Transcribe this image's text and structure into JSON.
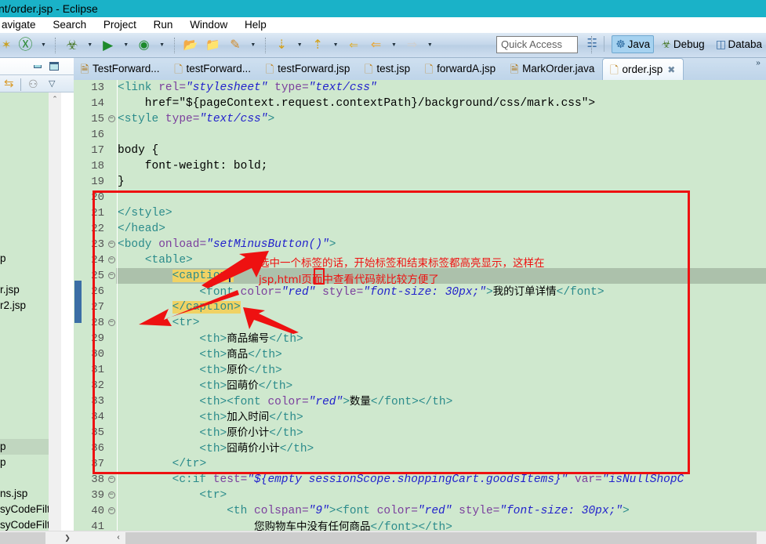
{
  "window": {
    "title": "nt/order.jsp - Eclipse",
    "titlebar_color": "#1ab2c8"
  },
  "menubar": {
    "items": [
      {
        "label": "avigate"
      },
      {
        "label": "Search"
      },
      {
        "label": "Project"
      },
      {
        "label": "Run"
      },
      {
        "label": "Window"
      },
      {
        "label": "Help"
      }
    ]
  },
  "toolbar": {
    "quick_access_placeholder": "Quick Access",
    "items": [
      {
        "name": "new-wizard-icon",
        "glyph": "✦",
        "color": "#c9a227"
      },
      {
        "name": "new-java-class-icon",
        "glyph": "Ⓖ",
        "color": "#2e8b37"
      },
      {
        "name": "new-dropdown-arrow",
        "glyph": "▼"
      },
      {
        "name": "debug-icon",
        "glyph": "☣",
        "color": "#4b7a2c"
      },
      {
        "name": "debug-dropdown-arrow",
        "glyph": "▼"
      },
      {
        "name": "run-icon",
        "glyph": "▶",
        "color": "#1d8a2c"
      },
      {
        "name": "run-dropdown-arrow",
        "glyph": "▼"
      },
      {
        "name": "run-as-server-icon",
        "glyph": "◉",
        "color": "#1d8a2c"
      },
      {
        "name": "run-as-dropdown-arrow",
        "glyph": "▼"
      },
      {
        "name": "open-type-icon",
        "glyph": "📂",
        "color": "#d99b2b"
      },
      {
        "name": "open-folder-icon",
        "glyph": "📁",
        "color": "#d99b2b"
      },
      {
        "name": "marker-pen-icon",
        "glyph": "✒",
        "color": "#d08a2a"
      },
      {
        "name": "marker-dropdown-arrow",
        "glyph": "▼"
      },
      {
        "name": "next-annotation-icon",
        "glyph": "⇣",
        "color": "#d4a017"
      },
      {
        "name": "next-annotation-dropdown-arrow",
        "glyph": "▼"
      },
      {
        "name": "previous-annotation-icon",
        "glyph": "⇡",
        "color": "#d4a017"
      },
      {
        "name": "previous-annotation-dropdown-arrow",
        "glyph": "▼"
      },
      {
        "name": "last-edit-location-icon",
        "glyph": "⇐",
        "color": "#e0b030"
      },
      {
        "name": "back-icon",
        "glyph": "⇐",
        "color": "#e8a83a"
      },
      {
        "name": "back-dropdown-arrow",
        "glyph": "▼"
      },
      {
        "name": "forward-icon",
        "glyph": "⇒",
        "color": "#cfcfcf"
      },
      {
        "name": "forward-dropdown-arrow",
        "glyph": "▼"
      }
    ]
  },
  "perspective_bar": {
    "open_perspective_icon": "open-perspective-icon",
    "items": [
      {
        "label": "Java",
        "icon": "java-perspective-icon",
        "active": true
      },
      {
        "label": "Debug",
        "icon": "debug-perspective-icon",
        "active": false
      },
      {
        "label": "Databa",
        "icon": "database-perspective-icon",
        "active": false
      }
    ]
  },
  "left_panel": {
    "minimize_label": "minimize",
    "maximize_label": "maximize",
    "tool_icons": [
      {
        "name": "link-with-editor-icon",
        "glyph": "⇆",
        "color": "#d99b2b"
      },
      {
        "name": "view-menu-collapse-icon",
        "glyph": "⚇",
        "color": "#8a8a8a"
      },
      {
        "name": "view-menu-icon",
        "glyph": "▽",
        "color": "#3c5a72"
      }
    ],
    "tree_items": [
      {
        "label": "",
        "selected": false
      },
      {
        "label": "",
        "selected": false
      },
      {
        "label": "",
        "selected": false
      },
      {
        "label": "",
        "selected": false
      },
      {
        "label": "",
        "selected": false
      },
      {
        "label": "",
        "selected": false
      },
      {
        "label": "",
        "selected": false
      },
      {
        "label": "",
        "selected": false
      },
      {
        "label": "",
        "selected": false
      },
      {
        "label": "",
        "selected": false
      },
      {
        "label": "p",
        "selected": false
      },
      {
        "label": "",
        "selected": false
      },
      {
        "label": "r.jsp",
        "selected": false
      },
      {
        "label": "r2.jsp",
        "selected": false
      },
      {
        "label": "",
        "selected": false
      },
      {
        "label": "",
        "selected": false
      },
      {
        "label": "",
        "selected": false
      },
      {
        "label": "",
        "selected": false
      },
      {
        "label": "",
        "selected": false
      },
      {
        "label": "",
        "selected": false
      },
      {
        "label": "",
        "selected": false
      },
      {
        "label": "",
        "selected": false
      },
      {
        "label": "p",
        "selected": true
      },
      {
        "label": "p",
        "selected": false
      },
      {
        "label": "",
        "selected": false
      },
      {
        "label": "ns.jsp",
        "selected": false
      },
      {
        "label": "syCodeFilter.",
        "selected": false
      },
      {
        "label": "syCodeFilterI",
        "selected": false
      }
    ],
    "scroll_up_icon": "⌃",
    "scroll_down_icon": "⌄",
    "scroll_right_icon": "❯"
  },
  "editor_tabs": {
    "more_tabs_icon": "»",
    "items": [
      {
        "label": "TestForward...",
        "icon": "java-file-icon",
        "active": false,
        "closable": false
      },
      {
        "label": "testForward...",
        "icon": "jsp-file-icon",
        "active": false,
        "closable": false
      },
      {
        "label": "testForward.jsp",
        "icon": "jsp-file-icon",
        "active": false,
        "closable": false
      },
      {
        "label": "test.jsp",
        "icon": "jsp-file-icon",
        "active": false,
        "closable": false
      },
      {
        "label": "forwardA.jsp",
        "icon": "jsp-file-icon",
        "active": false,
        "closable": false
      },
      {
        "label": "MarkOrder.java",
        "icon": "java-file-icon",
        "active": false,
        "closable": false
      },
      {
        "label": "order.jsp",
        "icon": "jsp-file-icon",
        "active": true,
        "closable": true,
        "close_icon": "✖"
      }
    ]
  },
  "editor": {
    "background_color": "#cfe8ce",
    "selected_line_number": 25,
    "lines": [
      {
        "n": 13,
        "fold": "",
        "text": "<link rel=\"stylesheet\" type=\"text/css\""
      },
      {
        "n": 14,
        "fold": "",
        "text": "    href=\"${pageContext.request.contextPath}/background/css/mark.css\">"
      },
      {
        "n": 15,
        "fold": "-",
        "text": "<style type=\"text/css\">"
      },
      {
        "n": 16,
        "fold": "",
        "text": ""
      },
      {
        "n": 17,
        "fold": "",
        "text": "body {"
      },
      {
        "n": 18,
        "fold": "",
        "text": "    font-weight: bold;"
      },
      {
        "n": 19,
        "fold": "",
        "text": "}"
      },
      {
        "n": 20,
        "fold": "",
        "text": ""
      },
      {
        "n": 21,
        "fold": "",
        "text": "</style>"
      },
      {
        "n": 22,
        "fold": "",
        "text": "</head>"
      },
      {
        "n": 23,
        "fold": "-",
        "text": "<body onload=\"setMinusButton()\">"
      },
      {
        "n": 24,
        "fold": "-",
        "text": "    <table>"
      },
      {
        "n": 25,
        "fold": "-",
        "text": "        <caption>"
      },
      {
        "n": 26,
        "fold": "",
        "text": "            <font color=\"red\" style=\"font-size: 30px;\">我的订单详情</font>"
      },
      {
        "n": 27,
        "fold": "",
        "text": "        </caption>"
      },
      {
        "n": 28,
        "fold": "-",
        "text": "        <tr>"
      },
      {
        "n": 29,
        "fold": "",
        "text": "            <th>商品编号</th>"
      },
      {
        "n": 30,
        "fold": "",
        "text": "            <th>商品</th>"
      },
      {
        "n": 31,
        "fold": "",
        "text": "            <th>原价</th>"
      },
      {
        "n": 32,
        "fold": "",
        "text": "            <th>囧萌价</th>"
      },
      {
        "n": 33,
        "fold": "",
        "text": "            <th><font color=\"red\">数量</font></th>"
      },
      {
        "n": 34,
        "fold": "",
        "text": "            <th>加入时间</th>"
      },
      {
        "n": 35,
        "fold": "",
        "text": "            <th>原价小计</th>"
      },
      {
        "n": 36,
        "fold": "",
        "text": "            <th>囧萌价小计</th>"
      },
      {
        "n": 37,
        "fold": "",
        "text": "        </tr>"
      },
      {
        "n": 38,
        "fold": "-",
        "text": "        <c:if test=\"${empty sessionScope.shoppingCart.goodsItems}\" var=\"isNullShopC"
      },
      {
        "n": 39,
        "fold": "-",
        "text": "            <tr>"
      },
      {
        "n": 40,
        "fold": "-",
        "text": "                <th colspan=\"9\"><font color=\"red\" style=\"font-size: 30px;\">"
      },
      {
        "n": 41,
        "fold": "",
        "text": "                    您购物车中没有任何商品</font></th>"
      }
    ],
    "highlighted_tags": [
      "<caption>",
      "</caption>"
    ],
    "highlight_color": "#f0d264",
    "scroll_left_icon": "‹",
    "scroll_right_icon": "›"
  },
  "annotations": {
    "rect_color": "#ee1111",
    "arrow_color": "#ee1111",
    "text_line1": "选中一个标签的话，开始标签和结束标签都高亮显示，这样在",
    "text_line2": "jsp,html页面中查看代码就比较方便了"
  }
}
